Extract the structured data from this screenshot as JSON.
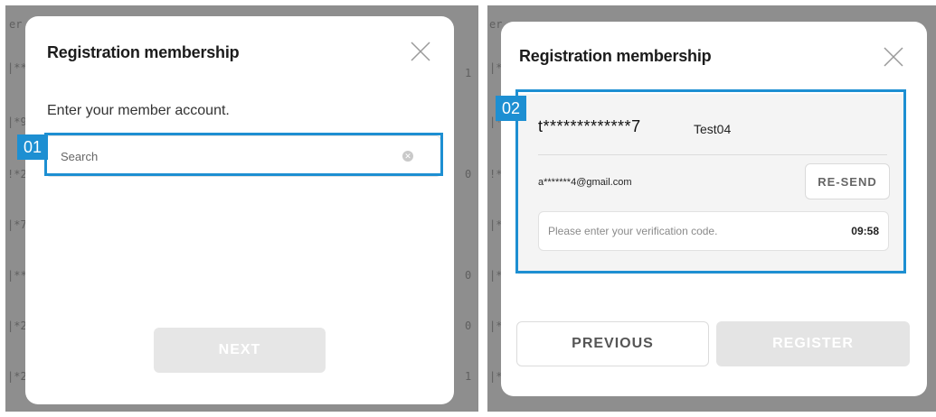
{
  "left_panel": {
    "bg_fragments": [
      "er",
      "|**",
      "1",
      "|*9",
      "!*2",
      "0",
      "|*7",
      "|**",
      "0",
      "|*2",
      "0",
      "|*2",
      "1"
    ],
    "modal": {
      "title": "Registration membership",
      "prompt": "Enter your member account.",
      "search": {
        "placeholder": "Search",
        "value": ""
      },
      "badge": "01",
      "next_label": "NEXT"
    }
  },
  "right_panel": {
    "bg_fragments": [
      "er",
      "|**",
      "|*9",
      "!*2",
      "|*7",
      "|**",
      "|*2",
      "|*2"
    ],
    "modal": {
      "title": "Registration membership",
      "badge": "02",
      "account": {
        "id": "t*************7",
        "name": "Test04",
        "email": "a*******4@gmail.com"
      },
      "resend_label": "RE-SEND",
      "code": {
        "placeholder": "Please enter your verification code.",
        "timer": "09:58"
      },
      "previous_label": "PREVIOUS",
      "register_label": "REGISTER"
    }
  },
  "colors": {
    "highlight": "#1d8fd2",
    "overlay": "#8e8e8e",
    "disabled_button": "#e6e6e6"
  }
}
